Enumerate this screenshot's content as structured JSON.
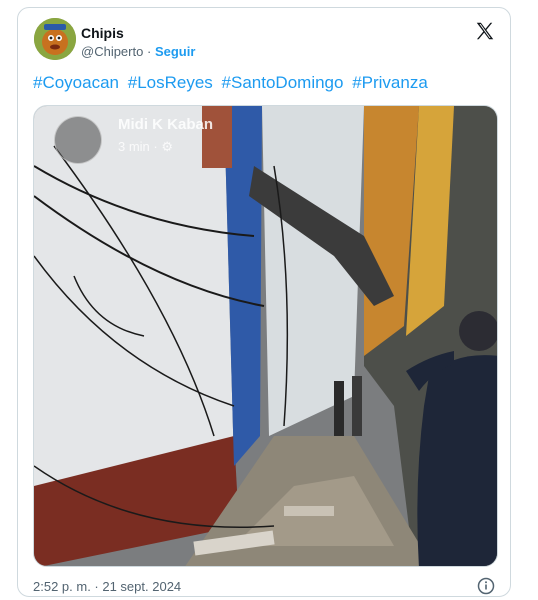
{
  "author": {
    "name": "Chipis",
    "handle": "@Chiperto",
    "separator": "·",
    "follow_label": "Seguir"
  },
  "tweet": {
    "hashtags": [
      "#Coyoacan",
      "#LosReyes",
      "#SantoDomingo",
      "#Privanza"
    ]
  },
  "media_overlay": {
    "name": "Midi K Kaban",
    "time": "3 min ·"
  },
  "footer": {
    "timestamp": "2:52 p. m. · 21 sept. 2024"
  },
  "colors": {
    "link": "#1d9bf0",
    "muted": "#536471",
    "border": "#cfd9de"
  },
  "icons": {
    "close": "x-logo-icon",
    "info": "info-icon",
    "settings": "gear-icon"
  }
}
